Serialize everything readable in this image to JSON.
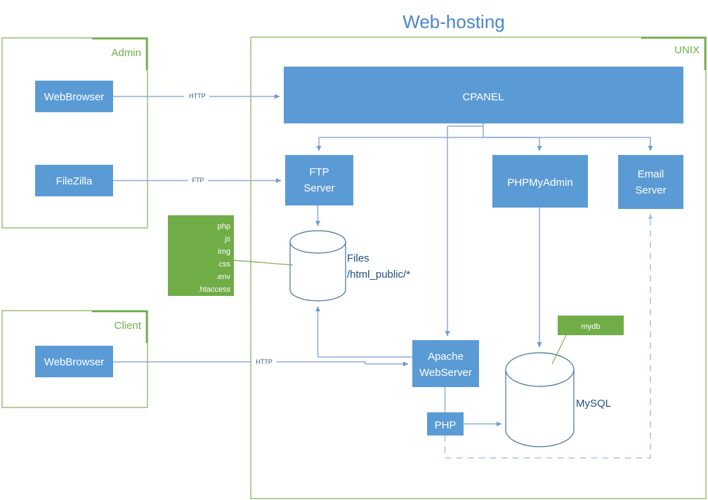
{
  "diagram": {
    "title": "Web-hosting",
    "groups": {
      "admin": {
        "label": "Admin"
      },
      "client": {
        "label": "Client"
      },
      "unix": {
        "label": "UNIX"
      }
    },
    "nodes": {
      "admin_webbrowser": {
        "label": "WebBrowser"
      },
      "filezilla": {
        "label": "FileZilla"
      },
      "client_webbrowser": {
        "label": "WebBrowser"
      },
      "cpanel": {
        "label": "CPANEL"
      },
      "ftp_server": {
        "label_line1": "FTP",
        "label_line2": "Server"
      },
      "phpmyadmin": {
        "label": "PHPMyAdmin"
      },
      "email_server": {
        "label_line1": "Email",
        "label_line2": "Server"
      },
      "apache": {
        "label_line1": "Apache",
        "label_line2": "WebServer"
      },
      "php": {
        "label": "PHP"
      },
      "files_store": {
        "label_line1": "Files",
        "label_line2": "/html_public/*"
      },
      "mysql_store": {
        "label": "MySQL"
      },
      "mydb_note": {
        "label": "mydb"
      },
      "filetypes_note": {
        "items": [
          "php",
          "js",
          "img",
          "css",
          ".env",
          ".htaccess"
        ]
      }
    },
    "edges": {
      "admin_http": {
        "label": "HTTP"
      },
      "admin_ftp": {
        "label": "FTP"
      },
      "client_http": {
        "label": "HTTP"
      }
    },
    "colors": {
      "node_blue": "#5B9BD5",
      "note_green": "#70AD47",
      "group_green": "#9CC47F",
      "title_blue": "#4a86c8",
      "connector_blue": "#8FAADC",
      "cylinder_stroke": "#41719C"
    }
  }
}
